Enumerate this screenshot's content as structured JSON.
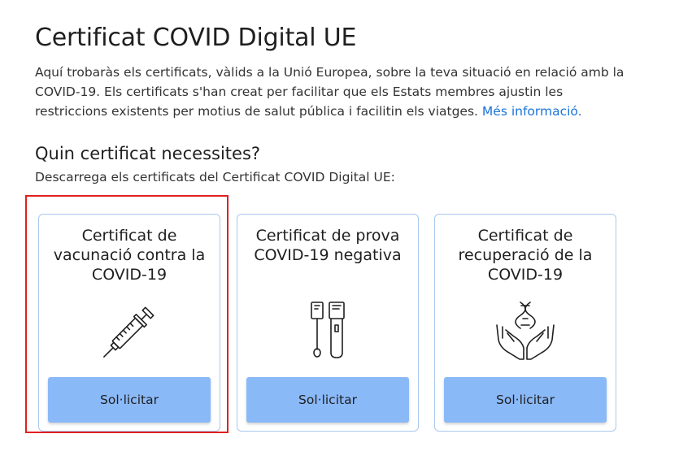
{
  "header": {
    "title": "Certificat COVID Digital UE",
    "intro_text": "Aquí trobaràs els certificats, vàlids a la Unió Europea, sobre la teva situació en relació amb la COVID-19. Els certificats s'han creat per facilitar que els Estats membres ajustin les restriccions existents per motius de salut pública i facilitin els viatges. ",
    "more_info_link": "Més informació."
  },
  "section": {
    "title": "Quin certificat necessites?",
    "subtitle": "Descarrega els certificats del Certificat COVID Digital UE:"
  },
  "cards": [
    {
      "title": "Certificat de vacunació contra la COVID-19",
      "icon": "syringe-icon",
      "button_label": "Sol·licitar",
      "highlighted": true
    },
    {
      "title": "Certificat de prova COVID-19 negativa",
      "icon": "test-tubes-icon",
      "button_label": "Sol·licitar",
      "highlighted": false
    },
    {
      "title": "Certificat de recuperació de la COVID-19",
      "icon": "hands-dna-icon",
      "button_label": "Sol·licitar",
      "highlighted": false
    }
  ],
  "colors": {
    "link": "#1a73d9",
    "button_bg": "#8ab9f8",
    "card_border": "#a9c8ee",
    "highlight_border": "#e02020"
  }
}
